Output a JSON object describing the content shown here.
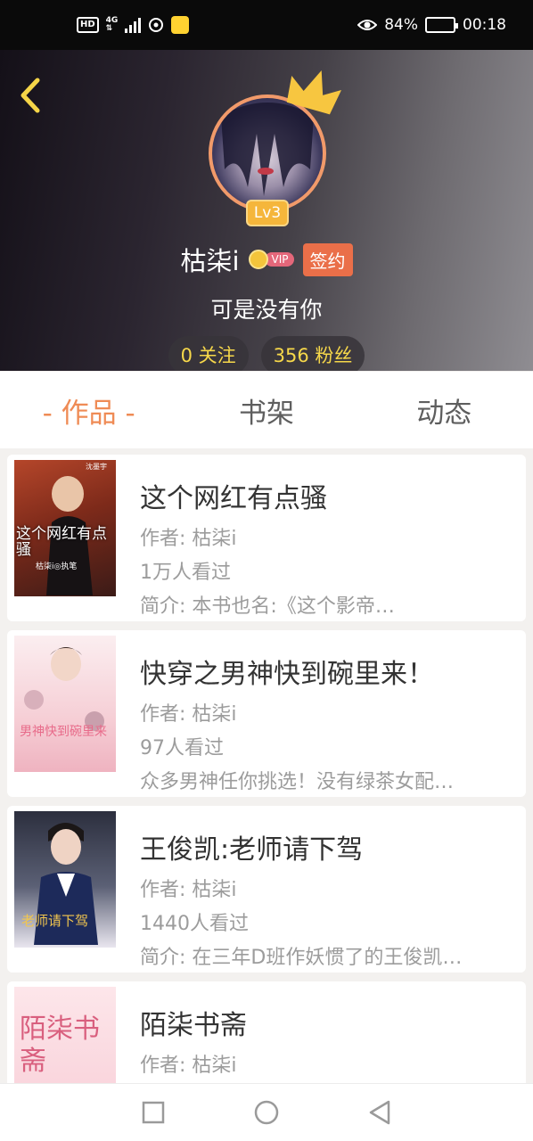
{
  "statusbar": {
    "hd_label": "HD",
    "net_label_top": "4G",
    "net_label_bottom": "⇅",
    "battery": "84%",
    "battery_level": 0.84,
    "time": "00:18"
  },
  "profile": {
    "level": "Lv3",
    "username": "枯柒i",
    "vip_label": "VIP",
    "sign_label": "签约",
    "signature": "可是没有你",
    "following": "0 关注",
    "followers": "356 粉丝"
  },
  "tabs": [
    {
      "label": "- 作品 -",
      "active": true
    },
    {
      "label": "书架",
      "active": false
    },
    {
      "label": "动态",
      "active": false
    }
  ],
  "books": [
    {
      "title": "这个网红有点骚",
      "author": "作者: 枯柒i",
      "views": "1万人看过",
      "intro": "简介: 本书也名:《这个影帝…",
      "cover_title": "这个网红有点骚",
      "cover_author": "枯柒i◎执笔",
      "cover_top": "沈墨宇"
    },
    {
      "title": "快穿之男神快到碗里来！",
      "author": "作者: 枯柒i",
      "views": "97人看过",
      "intro": "众多男神任你挑选！没有绿茶女配…",
      "cover_title": "男神快到碗里来"
    },
    {
      "title": "王俊凯:老师请下驾",
      "author": "作者: 枯柒i",
      "views": "1440人看过",
      "intro": "简介: 在三年D班作妖惯了的王俊凯…",
      "cover_title": "老师请下驾"
    },
    {
      "title": "陌柒书斋",
      "author": "作者: 枯柒i",
      "cover_title": "陌柒书斋"
    }
  ],
  "colors": {
    "accent": "#ef8b55",
    "follow_text": "#f7d84a",
    "level_badge": "#f5b63b",
    "sign_badge": "#ea6f49"
  }
}
